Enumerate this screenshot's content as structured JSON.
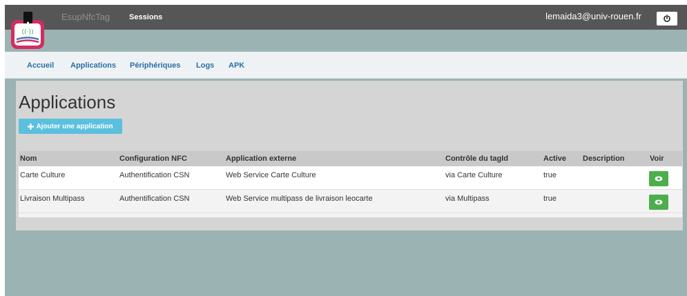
{
  "header": {
    "app_name": "EsupNfcTag",
    "sessions_label": "Sessions",
    "user_email": "lemaida3@univ-rouen.fr",
    "logout_icon": "power-icon"
  },
  "nav": {
    "items": [
      "Accueil",
      "Applications",
      "Périphériques",
      "Logs",
      "APK"
    ]
  },
  "page": {
    "title": "Applications",
    "add_button_label": "Ajouter une application"
  },
  "table": {
    "headers": [
      "Nom",
      "Configuration NFC",
      "Application externe",
      "Contrôle du tagId",
      "Active",
      "Description",
      "Voir"
    ],
    "rows": [
      [
        "Carte Culture",
        "Authentification CSN",
        "Web Service Carte Culture",
        "via Carte Culture",
        "true",
        ""
      ],
      [
        "Livraison Multipass",
        "Authentification CSN",
        "Web Service multipass de livraison leocarte",
        "via Multipass",
        "true",
        ""
      ]
    ]
  },
  "colors": {
    "topbar": "#565656",
    "background": "#9bb3b3",
    "link": "#2c6fa6",
    "info_button": "#5bc0de",
    "success_button": "#4cae4c"
  }
}
